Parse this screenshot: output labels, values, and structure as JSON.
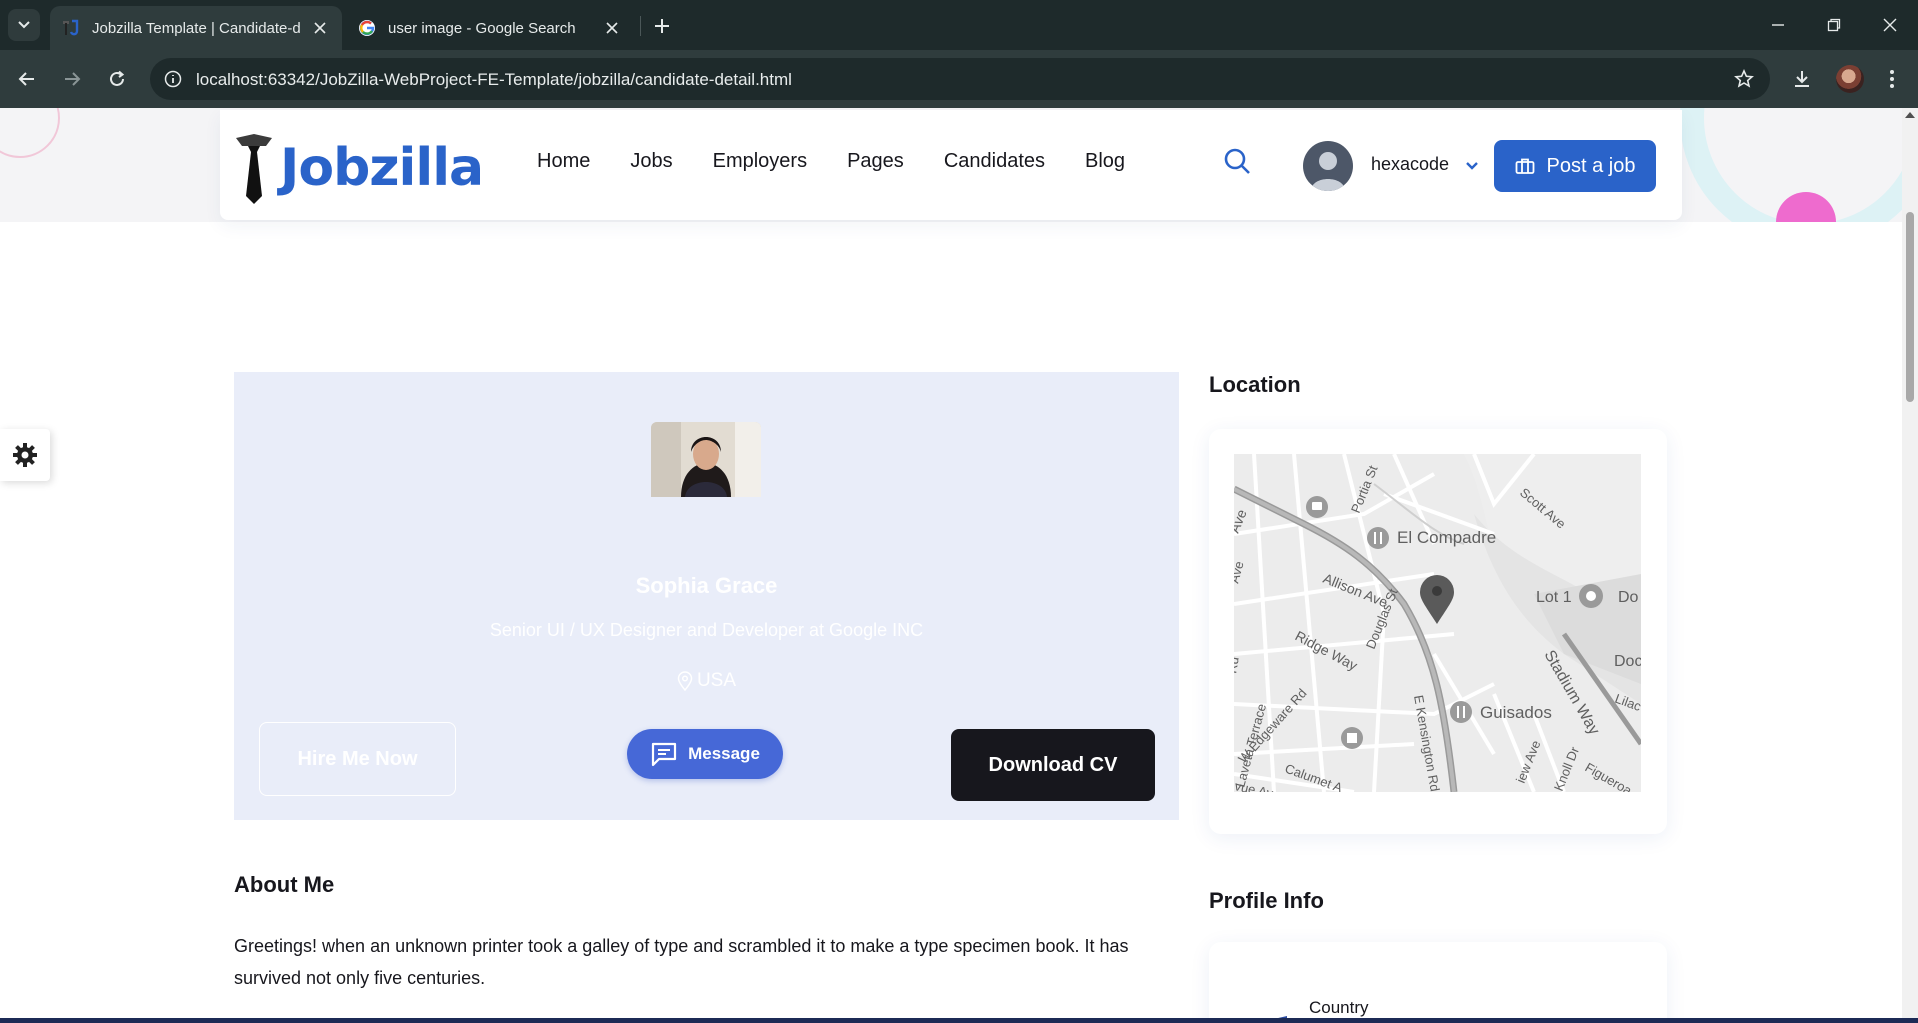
{
  "browser": {
    "tabs": [
      {
        "title": "Jobzilla Template | Candidate-d",
        "active": true,
        "favicon": "jobzilla-favicon"
      },
      {
        "title": "user image - Google Search",
        "active": false,
        "favicon": "google-g-icon"
      }
    ],
    "url": "localhost:63342/JobZilla-WebProject-FE-Template/jobzilla/candidate-detail.html"
  },
  "header": {
    "logo_text": "Jobzilla",
    "nav": [
      "Home",
      "Jobs",
      "Employers",
      "Pages",
      "Candidates",
      "Blog"
    ],
    "user_name": "hexacode",
    "post_job_label": "Post a job"
  },
  "candidate": {
    "name": "Sophia Grace",
    "role": "Senior UI / UX Designer and Developer at Google INC",
    "location": "USA",
    "hire_label": "Hire Me Now",
    "message_label": "Message",
    "download_label": "Download CV"
  },
  "about": {
    "title": "About Me",
    "text": "Greetings! when an unknown printer took a galley of type and scrambled it to make a type specimen book. It has survived not only five centuries."
  },
  "location": {
    "title": "Location",
    "map_labels": [
      "El Compadre",
      "Allison Ave",
      "Douglas St",
      "Ridge Way",
      "Lot 1",
      "Stadium Way",
      "Guisados",
      "W Edgeware Rd",
      "Calumet A",
      "E Kensington Rd",
      "Scott Ave",
      "Portia St",
      "Figueroa",
      "Laveta Terrace",
      "Do",
      "Doc",
      "Lilac",
      "Ave",
      "Ave",
      "Knoll Dr",
      "iew Ave",
      "vue Ave",
      "Rd"
    ]
  },
  "profile_info": {
    "title": "Profile Info",
    "first_label": "Country"
  },
  "colors": {
    "brand_blue": "#2a63c9",
    "message_blue": "#4668d7",
    "card_bg": "#e9edf9",
    "dark": "#17171d"
  }
}
